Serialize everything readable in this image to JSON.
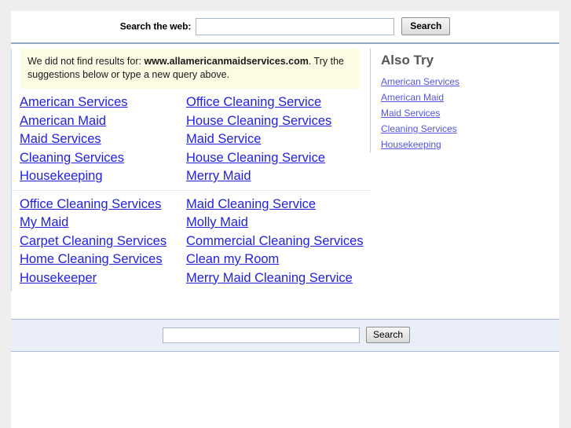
{
  "top_search": {
    "label": "Search the web:",
    "input_value": "",
    "input_placeholder": "",
    "button_label": "Search"
  },
  "notice": {
    "prefix": "We did not find results for: ",
    "query": "www.allamericanmaidservices.com",
    "suffix": ". Try the suggestions below or type a new query above."
  },
  "results": {
    "blocks": [
      {
        "rows": [
          {
            "left": "American Services",
            "right": "Office Cleaning Service"
          },
          {
            "left": "American Maid",
            "right": "House Cleaning Services"
          },
          {
            "left": "Maid Services",
            "right": "Maid Service"
          },
          {
            "left": "Cleaning Services",
            "right": "House Cleaning Service"
          },
          {
            "left": "Housekeeping",
            "right": "Merry Maid"
          }
        ]
      },
      {
        "rows": [
          {
            "left": "Office Cleaning Services",
            "right": "Maid Cleaning Service"
          },
          {
            "left": "My Maid",
            "right": "Molly Maid"
          },
          {
            "left": "Carpet Cleaning Services",
            "right": "Commercial Cleaning Services"
          },
          {
            "left": "Home Cleaning Services",
            "right": "Clean my Room"
          },
          {
            "left": "Housekeeper",
            "right": "Merry Maid Cleaning Service"
          }
        ]
      }
    ]
  },
  "also_try": {
    "heading": "Also Try",
    "items": [
      "American Services",
      "American Maid",
      "Maid Services",
      "Cleaning Services",
      "Housekeeping"
    ]
  },
  "bottom_search": {
    "input_value": "",
    "input_placeholder": "",
    "button_label": "Search"
  },
  "colors": {
    "page_background": "#eeeeee",
    "content_background": "#ffffff",
    "notice_background": "#fcfbe3",
    "link": "#2222dd",
    "also_try_link": "#5555dd",
    "also_try_heading": "#555555",
    "rule": "#93a8c6",
    "bottom_bar_background": "#e9eef8"
  }
}
